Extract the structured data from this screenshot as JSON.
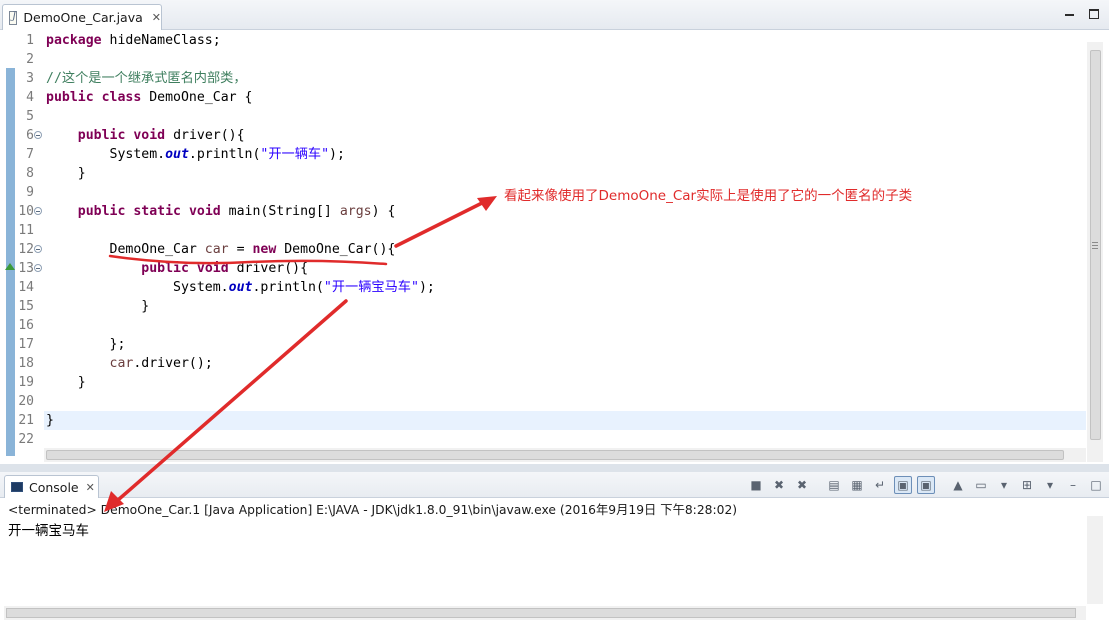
{
  "editor_tab": {
    "filename": "DemoOne_Car.java",
    "close_glyph": "✕",
    "file_icon": "java-file-icon"
  },
  "code": [
    {
      "num": "1",
      "tokens": [
        {
          "t": "package",
          "c": "kw"
        },
        {
          "t": " hideNameClass;"
        }
      ]
    },
    {
      "num": "2",
      "tokens": []
    },
    {
      "num": "3",
      "tokens": [
        {
          "t": "//这个是一个继承式匿名内部类，",
          "c": "cm"
        }
      ]
    },
    {
      "num": "4",
      "tokens": [
        {
          "t": "public",
          "c": "kw"
        },
        {
          "t": " "
        },
        {
          "t": "class",
          "c": "kw"
        },
        {
          "t": " DemoOne_Car {"
        }
      ]
    },
    {
      "num": "5",
      "tokens": []
    },
    {
      "num": "6",
      "tokens": [
        {
          "t": "    "
        },
        {
          "t": "public",
          "c": "kw"
        },
        {
          "t": " "
        },
        {
          "t": "void",
          "c": "kw"
        },
        {
          "t": " driver(){"
        }
      ]
    },
    {
      "num": "7",
      "tokens": [
        {
          "t": "        System."
        },
        {
          "t": "out",
          "c": "fd"
        },
        {
          "t": ".println("
        },
        {
          "t": "\"开一辆车\"",
          "c": "st"
        },
        {
          "t": ");"
        }
      ]
    },
    {
      "num": "8",
      "tokens": [
        {
          "t": "    }"
        }
      ]
    },
    {
      "num": "9",
      "tokens": []
    },
    {
      "num": "10",
      "tokens": [
        {
          "t": "    "
        },
        {
          "t": "public",
          "c": "kw"
        },
        {
          "t": " "
        },
        {
          "t": "static",
          "c": "kw"
        },
        {
          "t": " "
        },
        {
          "t": "void",
          "c": "kw"
        },
        {
          "t": " main(String[] "
        },
        {
          "t": "args",
          "c": "lv"
        },
        {
          "t": ") {"
        }
      ]
    },
    {
      "num": "11",
      "tokens": []
    },
    {
      "num": "12",
      "tokens": [
        {
          "t": "        DemoOne_Car "
        },
        {
          "t": "car",
          "c": "lv"
        },
        {
          "t": " = "
        },
        {
          "t": "new",
          "c": "kw"
        },
        {
          "t": " DemoOne_Car(){"
        }
      ]
    },
    {
      "num": "13",
      "tokens": [
        {
          "t": "            "
        },
        {
          "t": "public",
          "c": "kw"
        },
        {
          "t": " "
        },
        {
          "t": "void",
          "c": "kw"
        },
        {
          "t": " driver(){"
        }
      ]
    },
    {
      "num": "14",
      "tokens": [
        {
          "t": "                System."
        },
        {
          "t": "out",
          "c": "fd"
        },
        {
          "t": ".println("
        },
        {
          "t": "\"开一辆宝马车\"",
          "c": "st"
        },
        {
          "t": ");"
        }
      ]
    },
    {
      "num": "15",
      "tokens": [
        {
          "t": "            }"
        }
      ]
    },
    {
      "num": "16",
      "tokens": []
    },
    {
      "num": "17",
      "tokens": [
        {
          "t": "        };"
        }
      ]
    },
    {
      "num": "18",
      "tokens": [
        {
          "t": "        "
        },
        {
          "t": "car",
          "c": "lv"
        },
        {
          "t": ".driver();"
        }
      ]
    },
    {
      "num": "19",
      "tokens": [
        {
          "t": "    }"
        }
      ]
    },
    {
      "num": "20",
      "tokens": []
    },
    {
      "num": "21",
      "tokens": [
        {
          "t": "}"
        }
      ]
    },
    {
      "num": "22",
      "tokens": []
    }
  ],
  "fold_lines": [
    "6",
    "10",
    "12",
    "13"
  ],
  "override_marker_line": "13",
  "current_line": "21",
  "annotation": {
    "text": "看起来像使用了DemoOne_Car实际上是使用了它的一个匿名的子类",
    "color": "#e02b2b"
  },
  "console": {
    "tab_label": "Console",
    "close_glyph": "✕",
    "status": "<terminated> DemoOne_Car.1 [Java Application] E:\\JAVA - JDK\\jdk1.8.0_91\\bin\\javaw.exe (2016年9月19日 下午8:28:02)",
    "output": "开一辆宝马车",
    "toolbar": [
      {
        "name": "terminate-icon",
        "glyph": "■",
        "on": false
      },
      {
        "name": "remove-launch-icon",
        "glyph": "✖",
        "on": false
      },
      {
        "name": "remove-all-terminated-icon",
        "glyph": "✖",
        "on": false
      },
      {
        "name": "separator",
        "glyph": "",
        "on": false
      },
      {
        "name": "clear-console-icon",
        "glyph": "▤",
        "on": false
      },
      {
        "name": "scroll-lock-icon",
        "glyph": "▦",
        "on": false
      },
      {
        "name": "word-wrap-icon",
        "glyph": "↵",
        "on": false
      },
      {
        "name": "show-on-stdout-icon",
        "glyph": "▣",
        "on": true
      },
      {
        "name": "show-on-stderr-icon",
        "glyph": "▣",
        "on": true
      },
      {
        "name": "separator",
        "glyph": "",
        "on": false
      },
      {
        "name": "pin-console-icon",
        "glyph": "▲",
        "on": false
      },
      {
        "name": "display-console-icon",
        "glyph": "▭",
        "on": false
      },
      {
        "name": "dropdown-icon",
        "glyph": "▾",
        "on": false
      },
      {
        "name": "open-console-icon",
        "glyph": "⊞",
        "on": false
      },
      {
        "name": "dropdown-icon",
        "glyph": "▾",
        "on": false
      },
      {
        "name": "minimize-icon",
        "glyph": "–",
        "on": false
      },
      {
        "name": "maximize-icon",
        "glyph": "□",
        "on": false
      }
    ]
  },
  "colors": {
    "annotation_red": "#e02b2b",
    "keyword": "#7f0055",
    "comment": "#3f7f5f",
    "string": "#2a00ff",
    "field": "#0000c0",
    "local_variable": "#6a3e3e"
  }
}
